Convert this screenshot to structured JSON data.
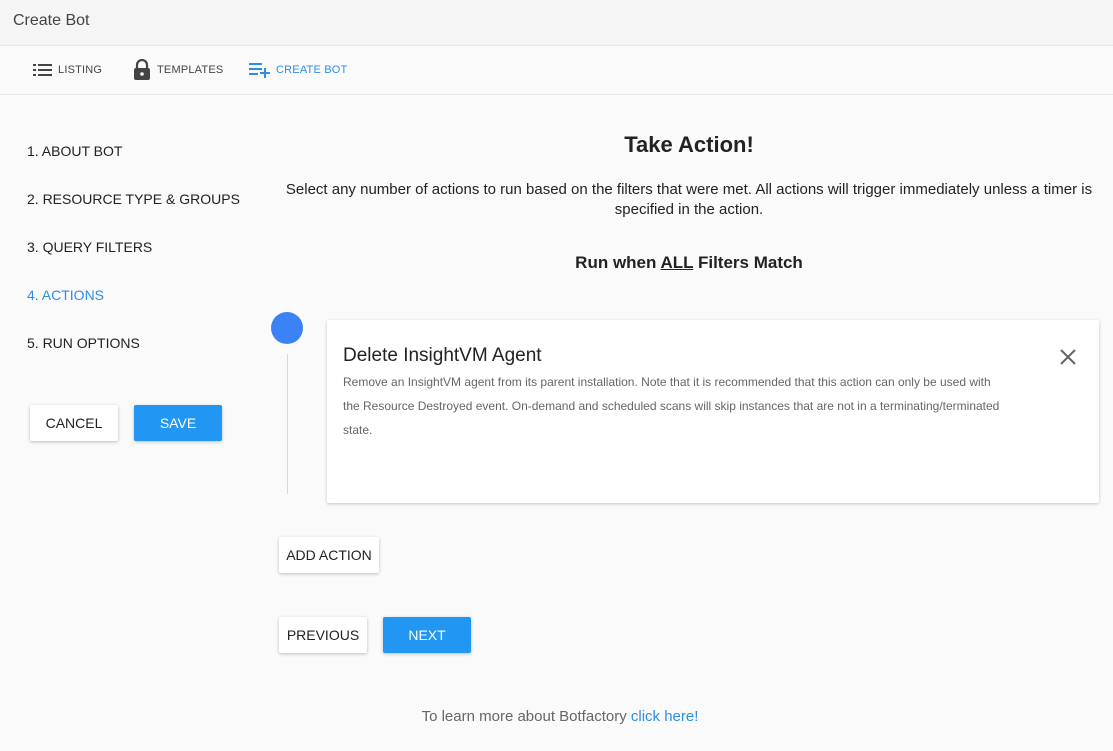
{
  "window": {
    "title": "Create Bot"
  },
  "nav": {
    "tabs": [
      {
        "label": "LISTING",
        "icon": "list-icon"
      },
      {
        "label": "TEMPLATES",
        "icon": "lock-icon"
      },
      {
        "label": "CREATE BOT",
        "icon": "playlist-add-icon",
        "active": true
      }
    ]
  },
  "steps": [
    {
      "label": "1. ABOUT BOT"
    },
    {
      "label": "2. RESOURCE TYPE & GROUPS"
    },
    {
      "label": "3. QUERY FILTERS"
    },
    {
      "label": "4. ACTIONS",
      "active": true
    },
    {
      "label": "5. RUN OPTIONS"
    }
  ],
  "sidebar_buttons": {
    "cancel": "CANCEL",
    "save": "SAVE"
  },
  "main": {
    "heading": "Take Action!",
    "instructions": "Select any number of actions to run based on the filters that were met. All actions will trigger immediately unless a timer is specified in the action.",
    "run_when_prefix": "Run when ",
    "run_when_emphasis": "ALL",
    "run_when_suffix": " Filters Match",
    "action_card": {
      "title": "Delete InsightVM Agent",
      "description": "Remove an InsightVM agent from its parent installation. Note that it is recommended that this action can only be used with the Resource Destroyed event. On-demand and scheduled scans will skip instances that are not in a terminating/terminated state."
    },
    "add_action": "ADD ACTION",
    "previous": "PREVIOUS",
    "next": "NEXT",
    "learn_more_text": "To learn more about Botfactory ",
    "learn_more_link": "click here!"
  },
  "colors": {
    "accent": "#2196f3",
    "link": "#2d8ee6",
    "timeline_dot": "#3b82f6"
  }
}
